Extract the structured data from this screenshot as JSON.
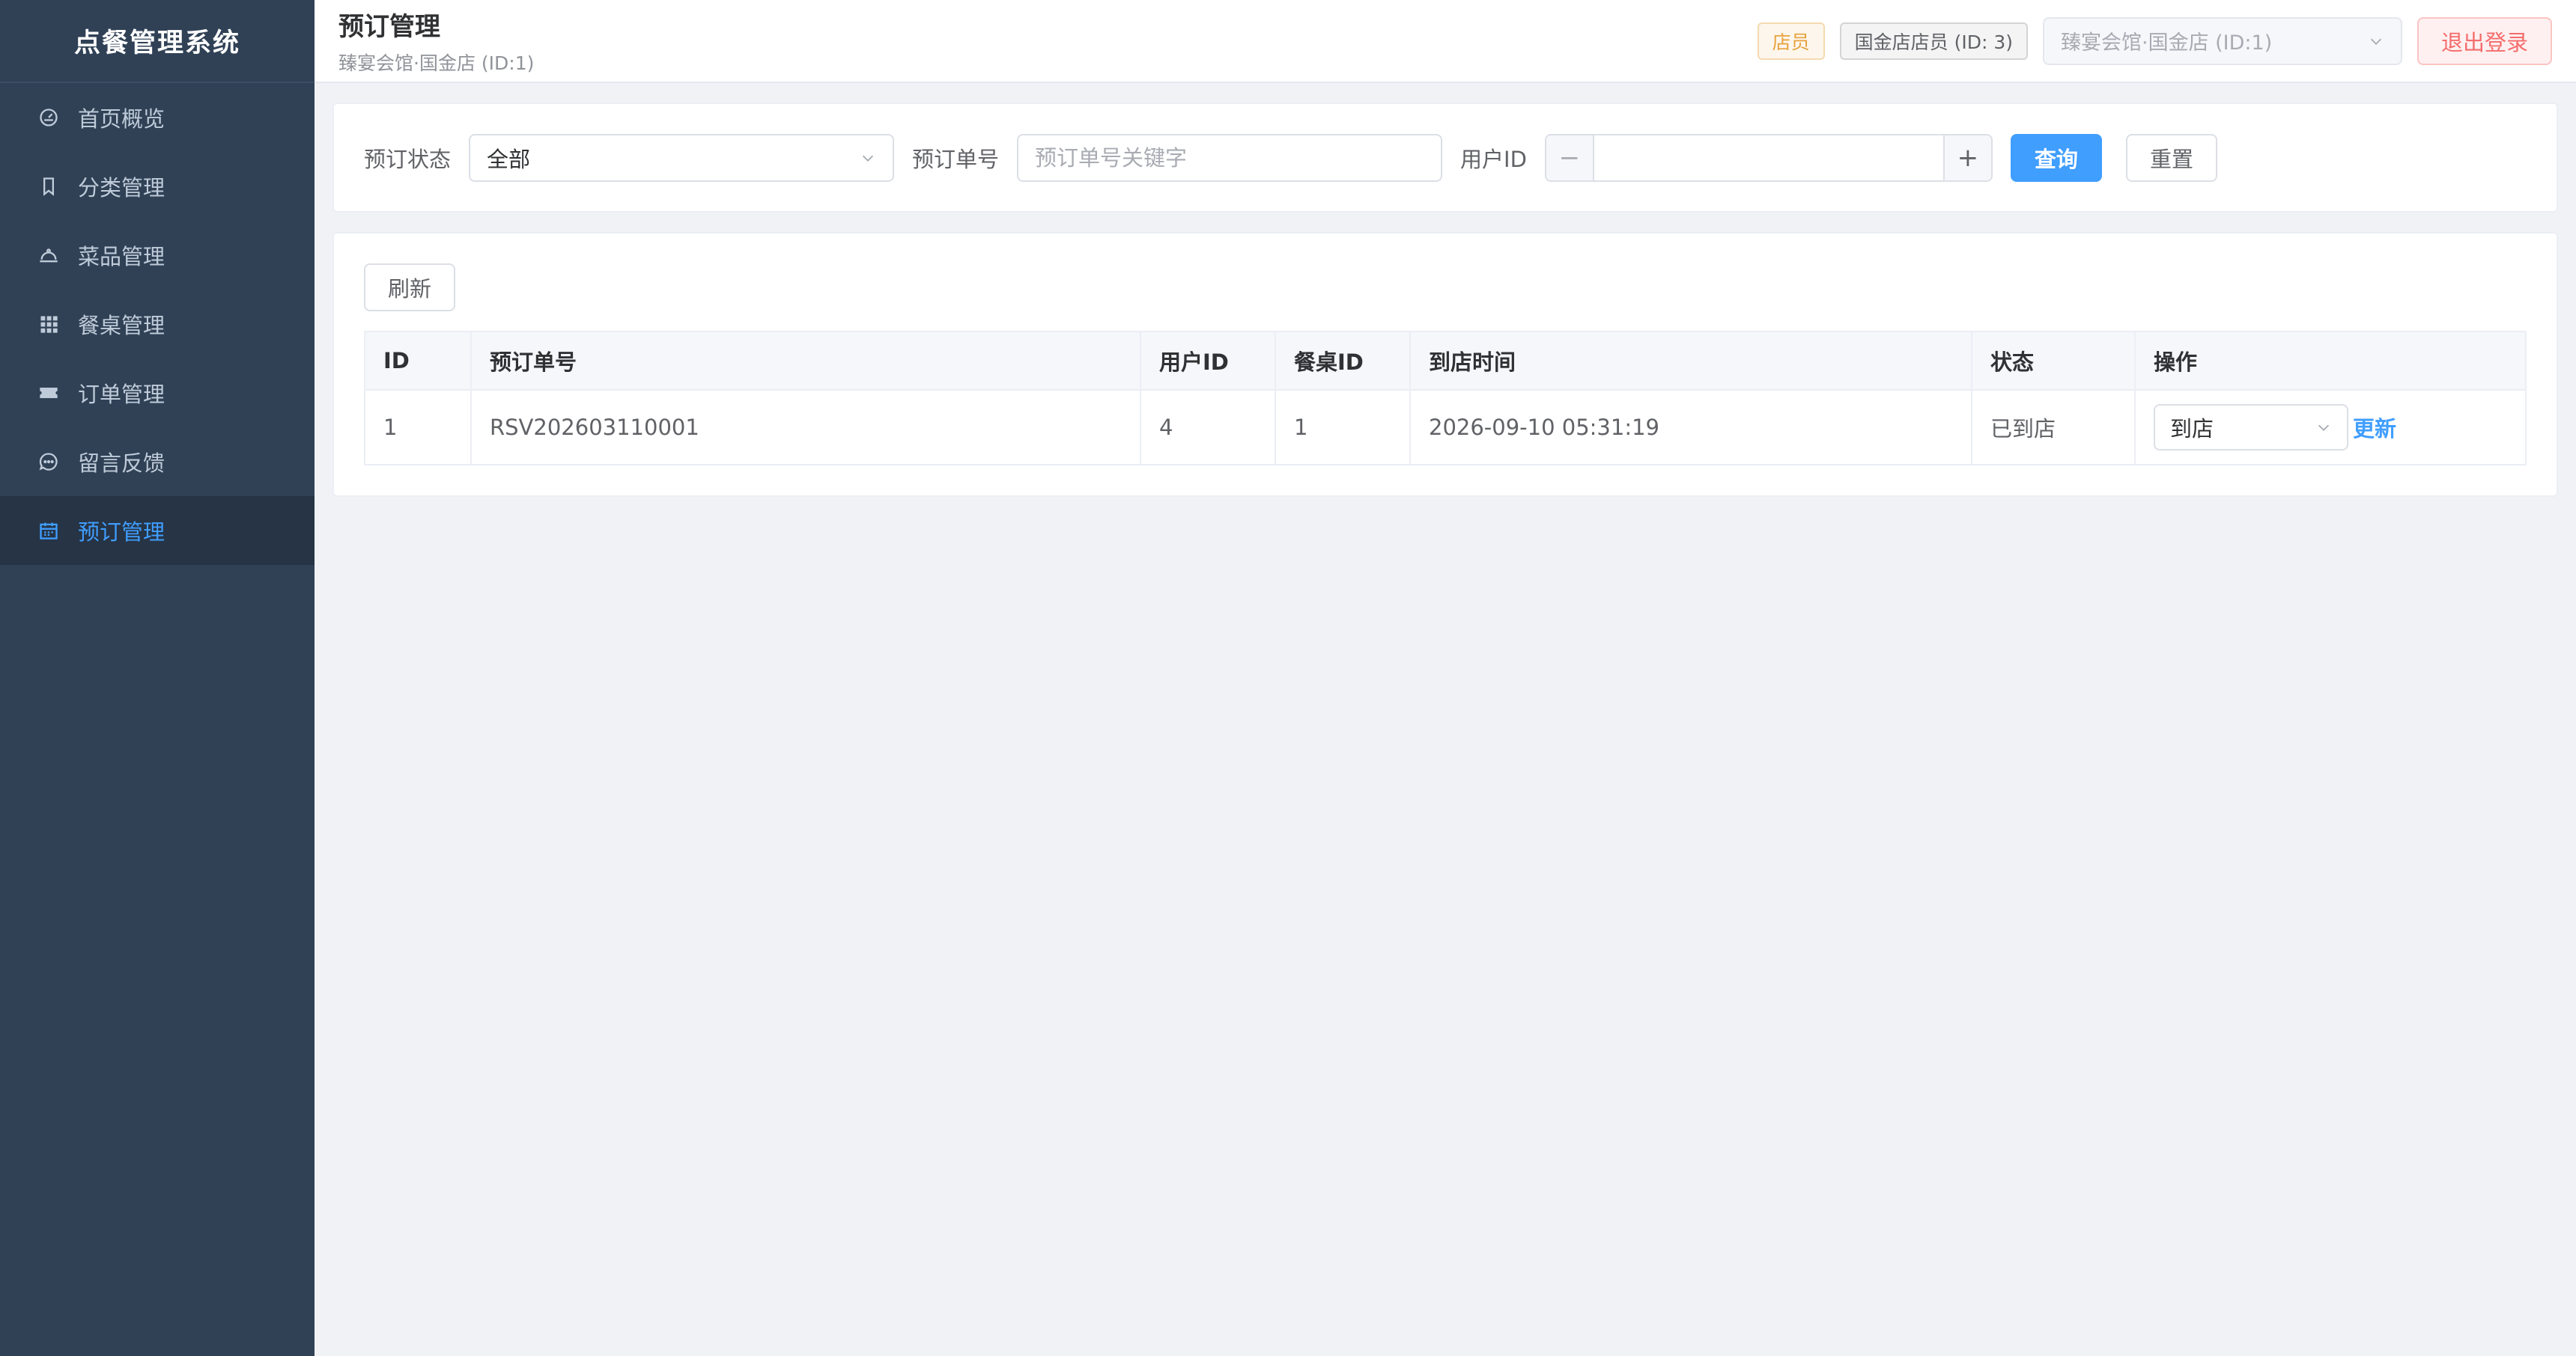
{
  "sidebar": {
    "title": "点餐管理系统",
    "items": [
      {
        "label": "首页概览",
        "icon": "dashboard-icon"
      },
      {
        "label": "分类管理",
        "icon": "bookmark-icon"
      },
      {
        "label": "菜品管理",
        "icon": "dish-cover-icon"
      },
      {
        "label": "餐桌管理",
        "icon": "grid-icon"
      },
      {
        "label": "订单管理",
        "icon": "ticket-icon"
      },
      {
        "label": "留言反馈",
        "icon": "chat-bubble-icon"
      },
      {
        "label": "预订管理",
        "icon": "calendar-icon",
        "active": true
      }
    ]
  },
  "header": {
    "title": "预订管理",
    "subtitle": "臻宴会馆·国金店 (ID:1)",
    "role_tag": "店员",
    "user_tag": "国金店店员 (ID: 3)",
    "store_select": "臻宴会馆·国金店 (ID:1)",
    "logout": "退出登录"
  },
  "filters": {
    "status_label": "预订状态",
    "status_value": "全部",
    "no_label": "预订单号",
    "no_placeholder": "预订单号关键字",
    "uid_label": "用户ID",
    "uid_value": "",
    "query": "查询",
    "reset": "重置"
  },
  "table": {
    "refresh": "刷新",
    "columns": [
      "ID",
      "预订单号",
      "用户ID",
      "餐桌ID",
      "到店时间",
      "状态",
      "操作"
    ],
    "rows": [
      {
        "id": "1",
        "no": "RSV202603110001",
        "uid": "4",
        "tid": "1",
        "time": "2026-09-10 05:31:19",
        "status": "已到店",
        "op_select": "到店",
        "op_link": "更新"
      }
    ]
  },
  "colors": {
    "sidebar_bg": "#304156",
    "sidebar_active_bg": "#263445",
    "accent": "#409eff",
    "danger": "#f56c6c",
    "warning": "#e6a23c"
  }
}
